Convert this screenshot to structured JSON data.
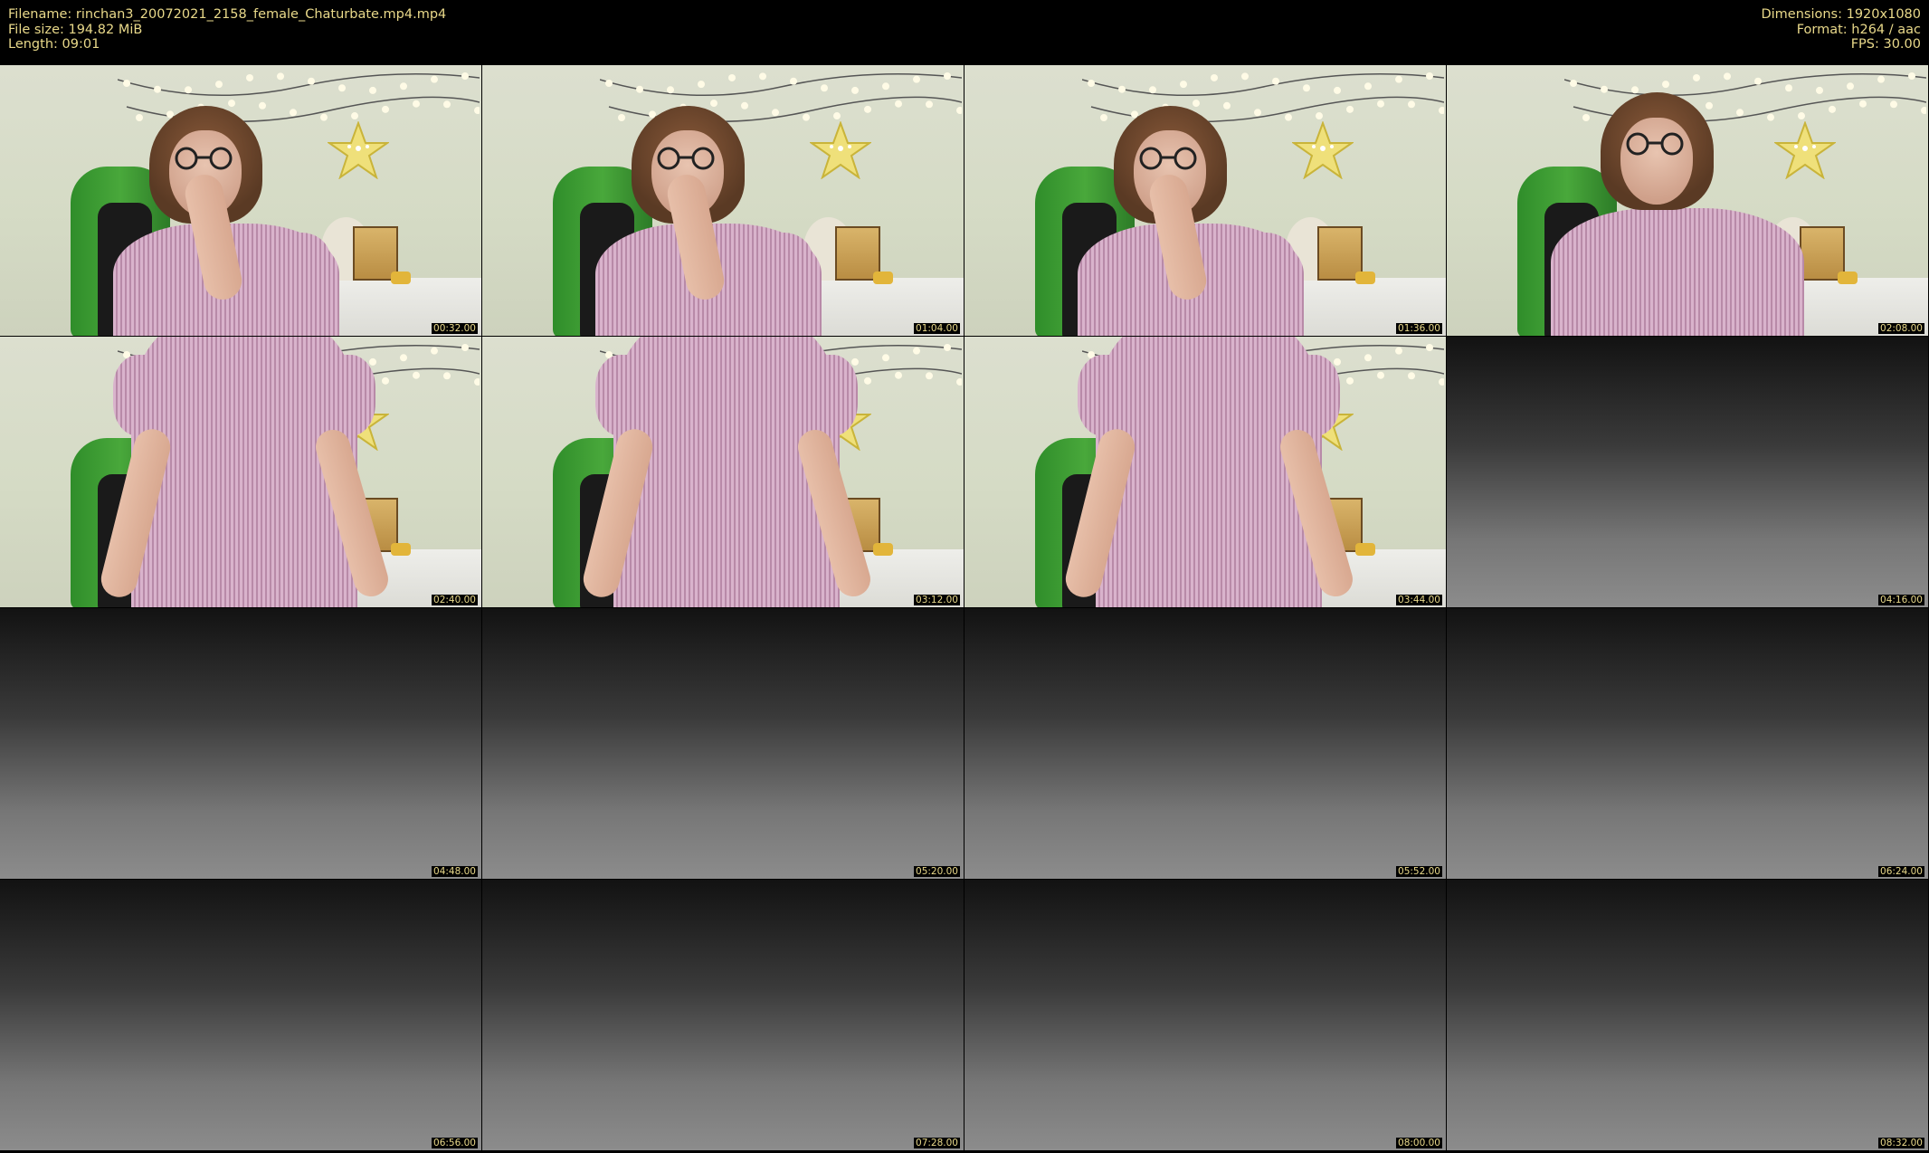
{
  "header": {
    "filename_line": "Filename: rinchan3_20072021_2158_female_Chaturbate.mp4.mp4",
    "filesize_line": "File size: 194.82 MiB",
    "length_line": "Length: 09:01",
    "dimensions_line": "Dimensions: 1920x1080",
    "format_line": "Format: h264 / aac",
    "fps_line": "FPS: 30.00"
  },
  "colors": {
    "header_text": "#e9d98a",
    "background": "#000000"
  },
  "frames": [
    {
      "timestamp": "00:32.00",
      "scene": "room-seated-chin-on-hand"
    },
    {
      "timestamp": "01:04.00",
      "scene": "room-seated-chin-on-hand"
    },
    {
      "timestamp": "01:36.00",
      "scene": "room-seated-chin-on-hand"
    },
    {
      "timestamp": "02:08.00",
      "scene": "room-seated-looking"
    },
    {
      "timestamp": "02:40.00",
      "scene": "room-standing-dress"
    },
    {
      "timestamp": "03:12.00",
      "scene": "room-standing-dress"
    },
    {
      "timestamp": "03:44.00",
      "scene": "room-standing-dress"
    },
    {
      "timestamp": "04:16.00",
      "scene": "dark-gradient"
    },
    {
      "timestamp": "04:48.00",
      "scene": "dark-gradient"
    },
    {
      "timestamp": "05:20.00",
      "scene": "dark-gradient"
    },
    {
      "timestamp": "05:52.00",
      "scene": "dark-gradient"
    },
    {
      "timestamp": "06:24.00",
      "scene": "dark-gradient"
    },
    {
      "timestamp": "06:56.00",
      "scene": "dark-gradient"
    },
    {
      "timestamp": "07:28.00",
      "scene": "dark-gradient"
    },
    {
      "timestamp": "08:00.00",
      "scene": "dark-gradient"
    },
    {
      "timestamp": "08:32.00",
      "scene": "dark-gradient"
    }
  ]
}
